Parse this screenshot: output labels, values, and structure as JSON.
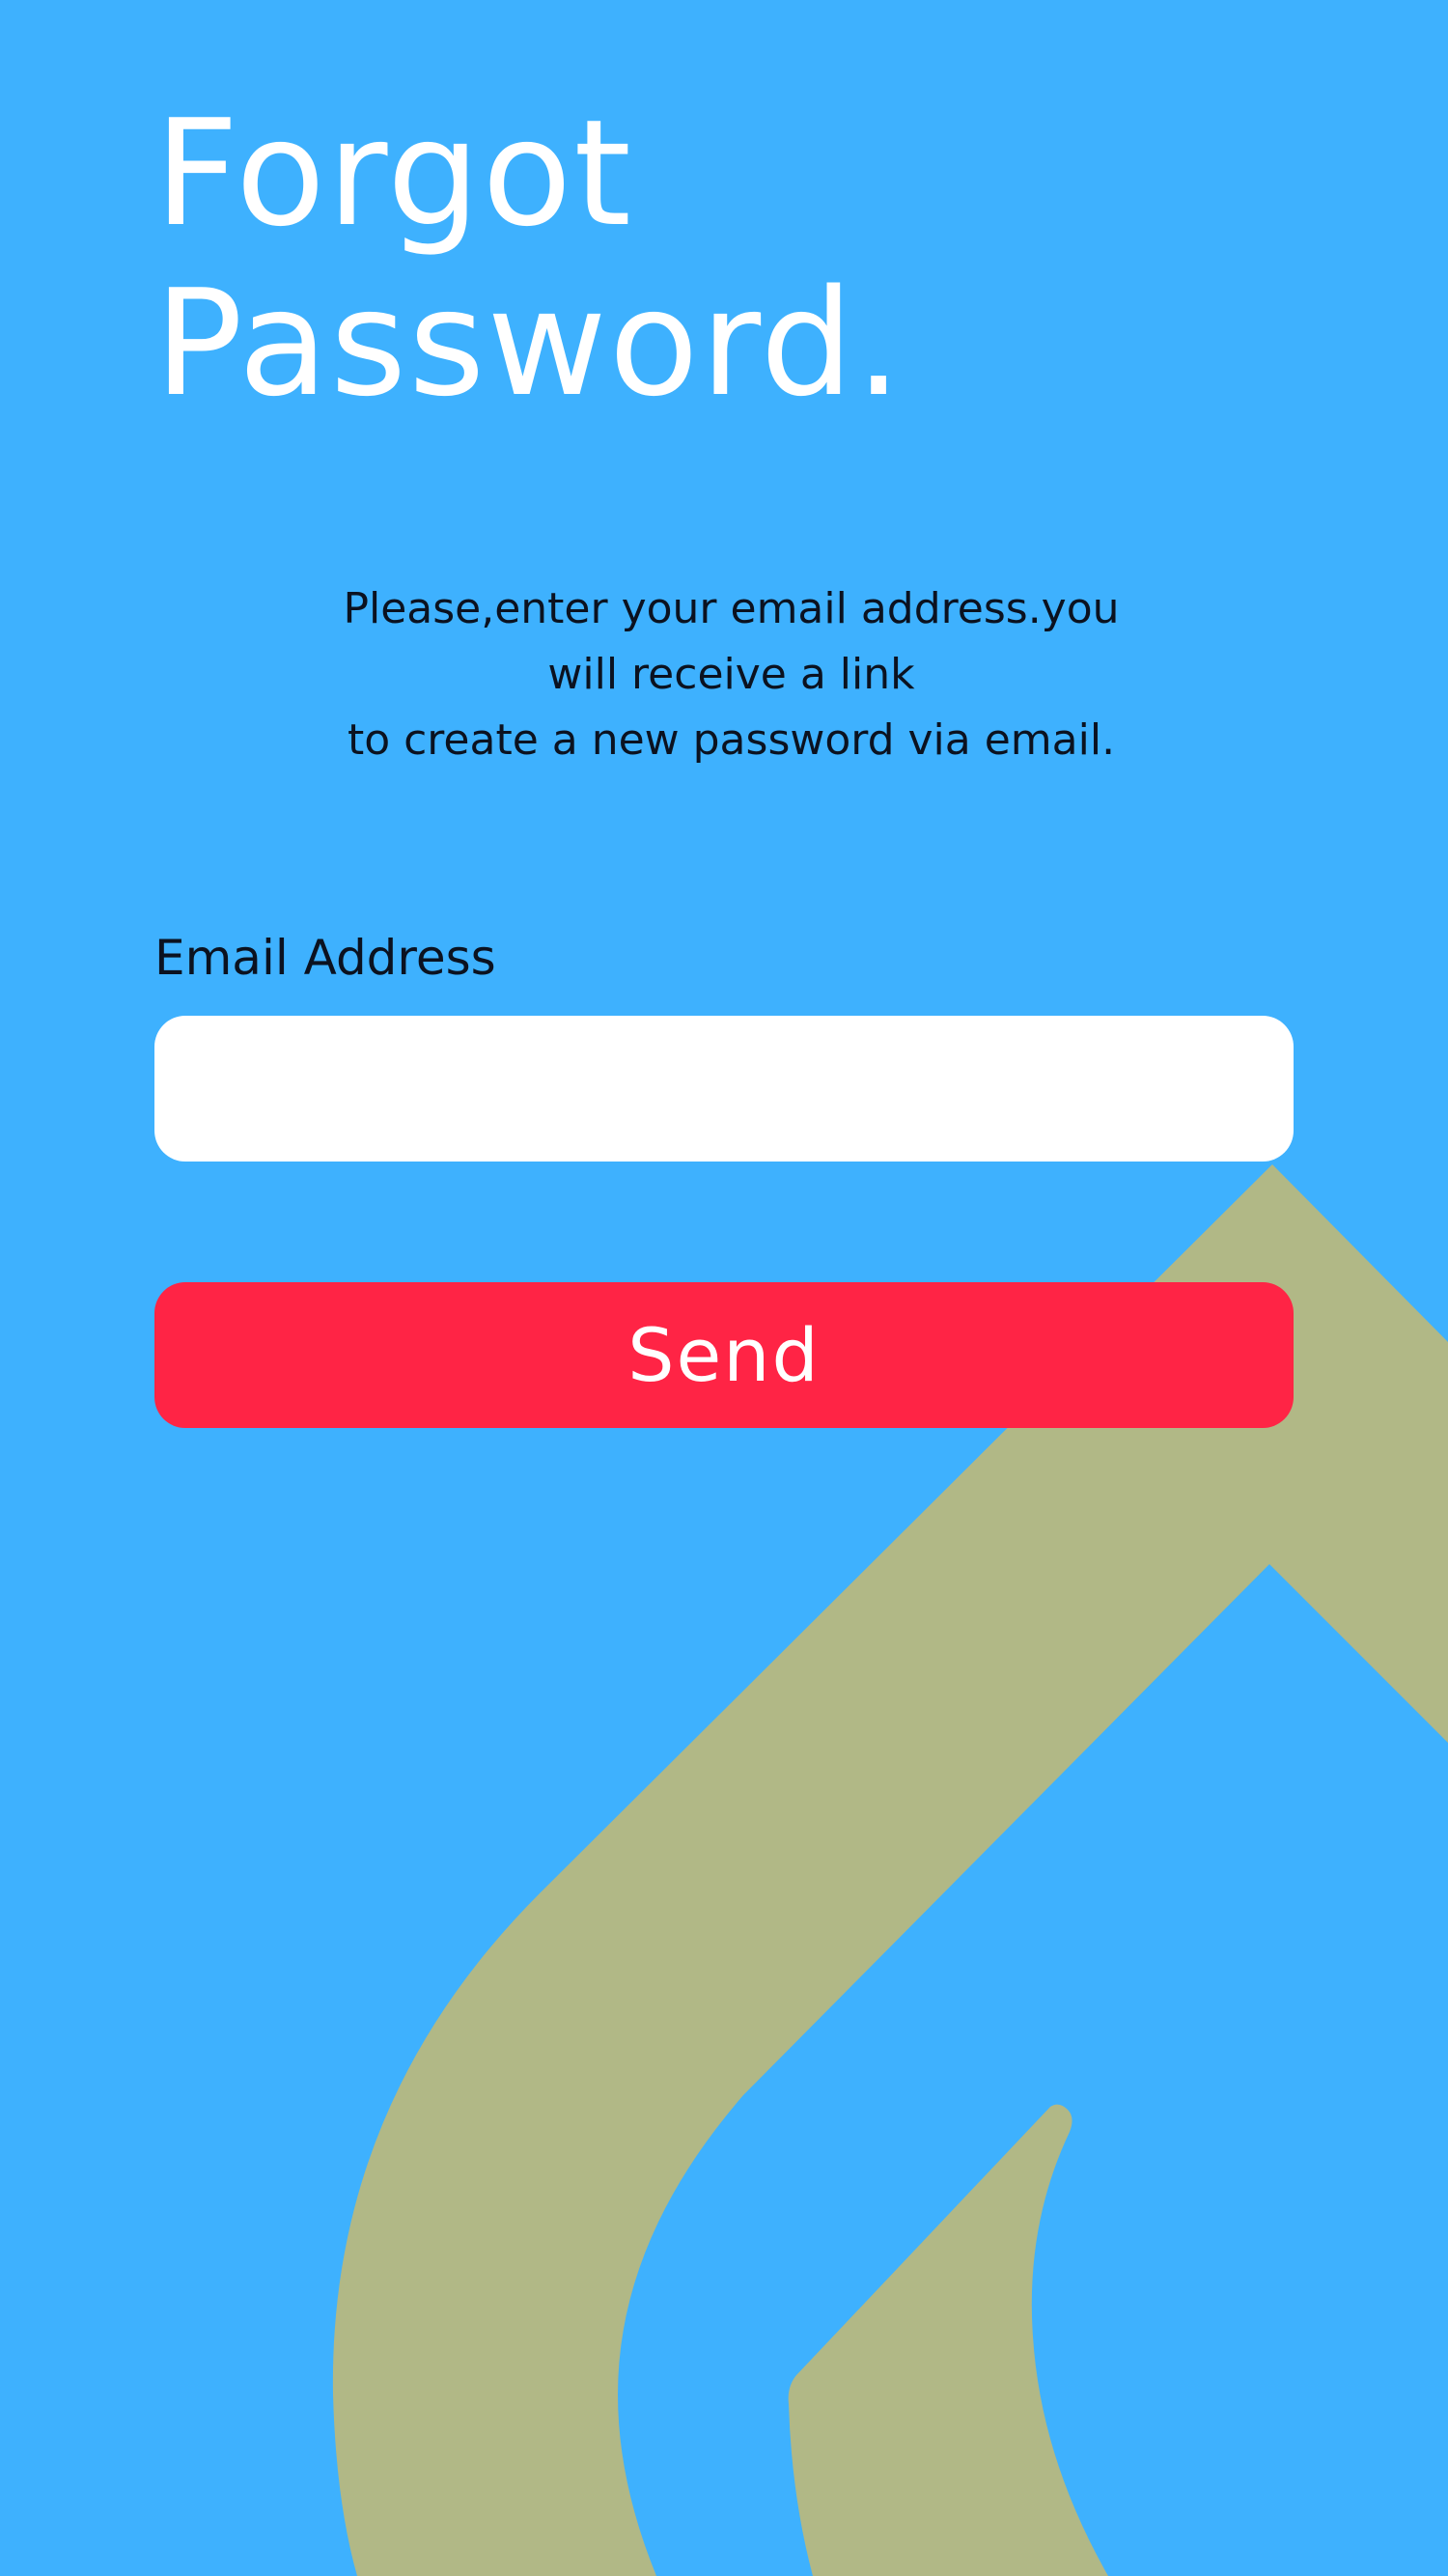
{
  "title": {
    "line1": "Forgot",
    "line2": "Password."
  },
  "instructions": {
    "line1": "Please,enter your email address.you",
    "line2": "will receive a link",
    "line3": "to create a new password via email."
  },
  "form": {
    "email_label": "Email Address",
    "email_value": "",
    "email_placeholder": "",
    "send_label": "Send"
  },
  "colors": {
    "background": "#3eb1fe",
    "accent_button": "#ff2445",
    "decor_shape": "#b1b886",
    "title_text": "#ffffff",
    "body_text": "#0b1220"
  },
  "icons": {
    "background_art": "house-outline-art"
  }
}
